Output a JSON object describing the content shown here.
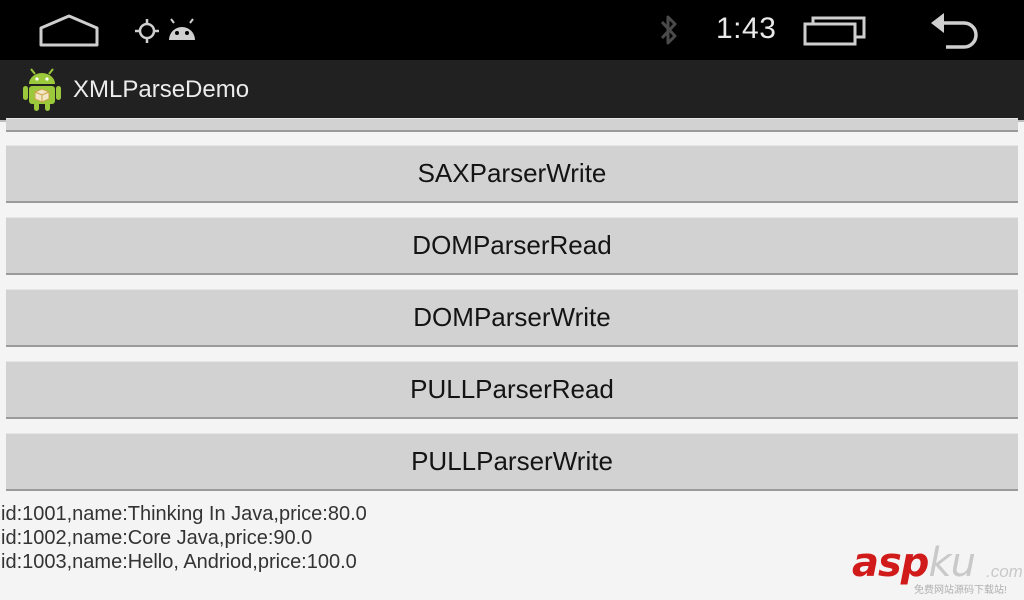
{
  "status_bar": {
    "time": "1:43",
    "icons": [
      "home-icon",
      "gps-icon",
      "android-debug-icon",
      "bluetooth-icon",
      "recents-icon",
      "back-icon"
    ]
  },
  "action_bar": {
    "title": "XMLParseDemo",
    "icon": "android-app-icon"
  },
  "buttons": [
    {
      "label": "SAXParserWrite"
    },
    {
      "label": "DOMParserRead"
    },
    {
      "label": "DOMParserWrite"
    },
    {
      "label": "PULLParserRead"
    },
    {
      "label": "PULLParserWrite"
    }
  ],
  "output": {
    "lines": [
      "id:1001,name:Thinking In Java,price:80.0",
      "id:1002,name:Core Java,price:90.0",
      "id:1003,name:Hello, Andriod,price:100.0"
    ]
  },
  "watermark": {
    "brand_a": "asp",
    "brand_b": "ku",
    "domain": ".com",
    "tagline": "免费网站源码下载站!"
  },
  "colors": {
    "status_bg": "#000000",
    "action_bar_bg": "#212121",
    "button_bg": "#d2d2d2",
    "watermark_red": "#d11a1a"
  }
}
